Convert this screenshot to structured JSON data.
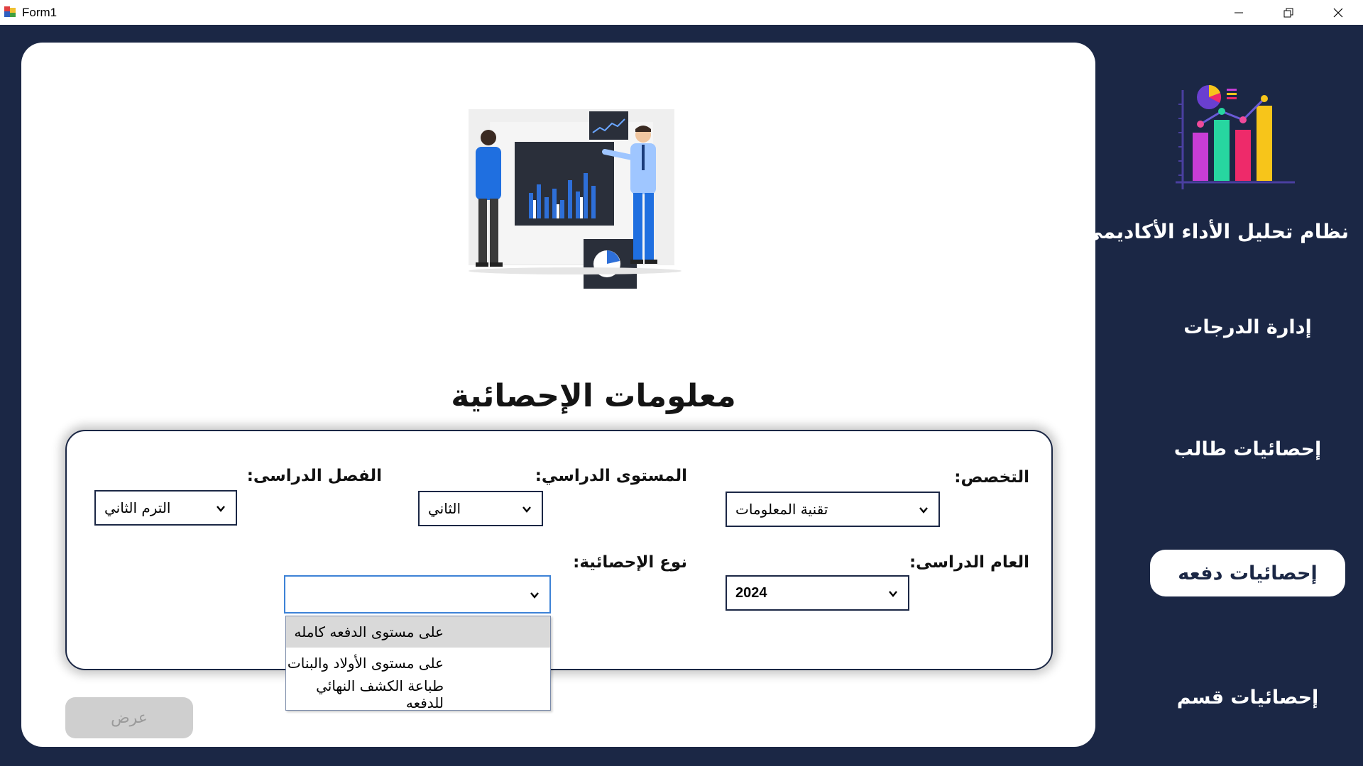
{
  "window": {
    "title": "Form1",
    "controls": [
      "minimize-icon",
      "restore-icon",
      "close-icon"
    ]
  },
  "sidebar": {
    "system_title": "نظام تحليل الأداء الأكاديمي",
    "items": [
      {
        "label": "إدارة الدرجات",
        "active": false
      },
      {
        "label": "إحصائيات طالب",
        "active": false
      },
      {
        "label": "إحصائيات دفعه",
        "active": true
      },
      {
        "label": "إحصائيات قسم",
        "active": false
      }
    ]
  },
  "main": {
    "title": "معلومات الإحصائية",
    "fields": {
      "specialization": {
        "label": "التخصص:",
        "value": "تقنية المعلومات"
      },
      "level": {
        "label": "المستوى الدراسي:",
        "value": "الثاني"
      },
      "semester": {
        "label": "الفصل الدراسى:",
        "value": "الترم الثاني"
      },
      "year": {
        "label": "العام الدراسى:",
        "value": "2024"
      },
      "stat_type": {
        "label": "نوع الإحصائية:",
        "value": "",
        "options": [
          "على مستوى الدفعه كامله",
          "على مستوى الأولاد والبنات",
          "طباعة الكشف النهائي للدفعه"
        ],
        "highlighted_index": 0
      }
    },
    "show_button_label": "عرض"
  },
  "colors": {
    "sidebar_bg": "#1b2745",
    "card_bg": "#ffffff",
    "focus_border": "#3d82d6",
    "disabled_button": "#cfcfcf"
  }
}
